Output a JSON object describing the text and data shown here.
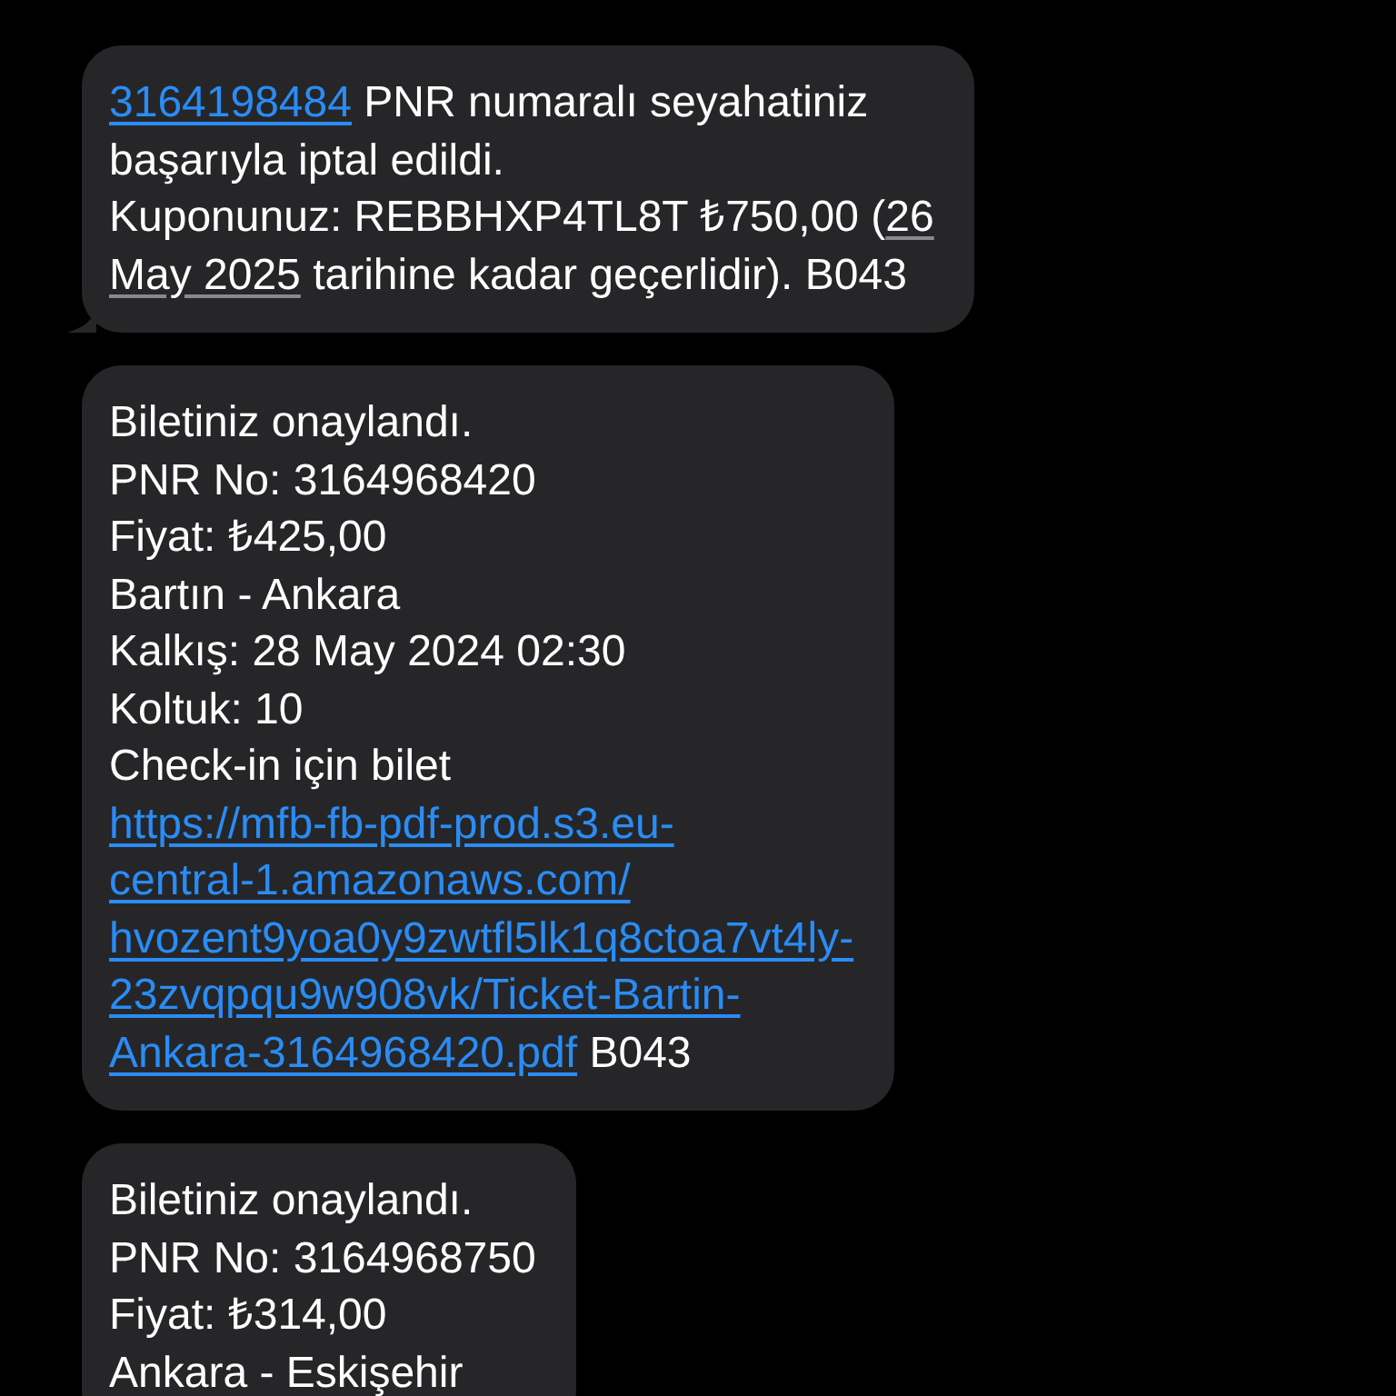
{
  "messages": [
    {
      "lines": [
        [
          {
            "kind": "link",
            "text": "3164198484"
          },
          {
            "kind": "text",
            "text": " PNR numaralı seyahatiniz"
          }
        ],
        [
          {
            "kind": "text",
            "text": "başarıyla iptal edildi."
          }
        ],
        [
          {
            "kind": "text",
            "text": "Kuponunuz: REBBHXP4TL8T ₺750,00 ("
          },
          {
            "kind": "date",
            "text": "26"
          }
        ],
        [
          {
            "kind": "date",
            "text": "May 2025"
          },
          {
            "kind": "text",
            "text": " tarihine kadar geçerlidir). B043"
          }
        ]
      ]
    },
    {
      "lines": [
        [
          {
            "kind": "text",
            "text": "Biletiniz onaylandı."
          }
        ],
        [
          {
            "kind": "text",
            "text": "PNR No: 3164968420"
          }
        ],
        [
          {
            "kind": "text",
            "text": "Fiyat: ₺425,00"
          }
        ],
        [
          {
            "kind": "text",
            "text": "Bartın - Ankara"
          }
        ],
        [
          {
            "kind": "text",
            "text": "Kalkış: 28 May 2024 02:30"
          }
        ],
        [
          {
            "kind": "text",
            "text": "Koltuk: 10"
          }
        ],
        [
          {
            "kind": "text",
            "text": "Check-in için bilet"
          }
        ],
        [
          {
            "kind": "link",
            "text": "https://mfb-fb-pdf-prod.s3.eu-"
          }
        ],
        [
          {
            "kind": "link",
            "text": "central-1.amazonaws.com/"
          }
        ],
        [
          {
            "kind": "link",
            "text": "hvozent9yoa0y9zwtfl5lk1q8ctoa7vt4ly-"
          }
        ],
        [
          {
            "kind": "link",
            "text": "23zvqpqu9w908vk/Ticket-Bartin-"
          }
        ],
        [
          {
            "kind": "link",
            "text": "Ankara-3164968420.pdf"
          },
          {
            "kind": "text",
            "text": " B043"
          }
        ]
      ]
    },
    {
      "lines": [
        [
          {
            "kind": "text",
            "text": "Biletiniz onaylandı."
          }
        ],
        [
          {
            "kind": "text",
            "text": "PNR No: 3164968750"
          }
        ],
        [
          {
            "kind": "text",
            "text": "Fiyat: ₺314,00"
          }
        ],
        [
          {
            "kind": "text",
            "text": "Ankara - Eskişehir"
          }
        ]
      ]
    }
  ]
}
